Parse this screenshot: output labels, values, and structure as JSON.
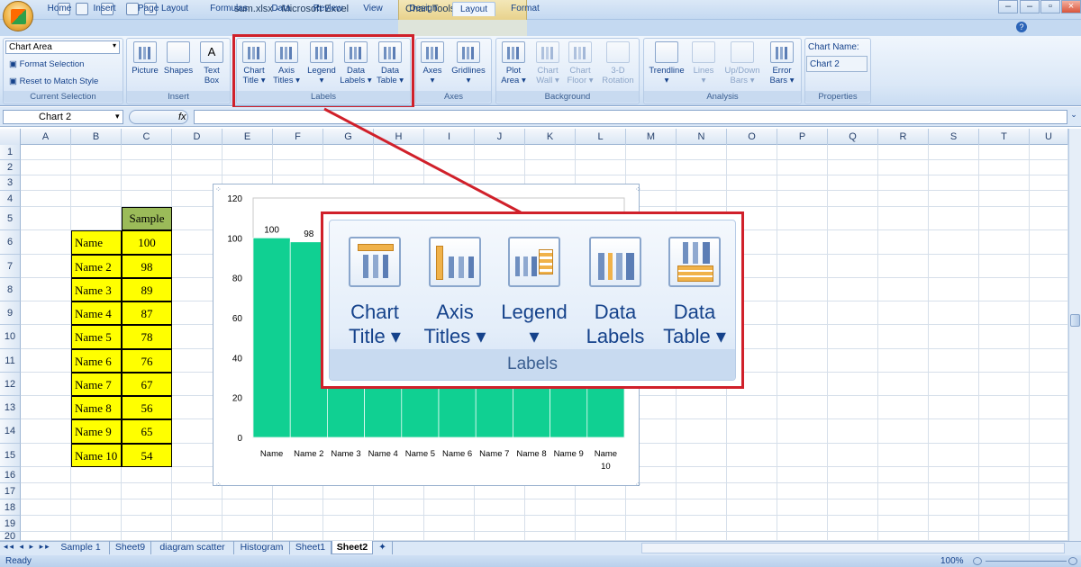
{
  "titlebar": {
    "title": "sum.xlsx - Microsoft Excel",
    "context_tab": "Chart Tools"
  },
  "tabs": [
    "Home",
    "Insert",
    "Page Layout",
    "Formulas",
    "Data",
    "Review",
    "View",
    "Design",
    "Layout",
    "Format"
  ],
  "active_tab": "Layout",
  "ribbon": {
    "current_selection": {
      "dropdown": "Chart Area",
      "format": "Format Selection",
      "reset": "Reset to Match Style",
      "label": "Current Selection"
    },
    "insert": {
      "label": "Insert",
      "buttons": [
        "Picture",
        "Shapes",
        "Text Box"
      ]
    },
    "labels": {
      "label": "Labels",
      "buttons": [
        [
          "Chart",
          "Title ▾"
        ],
        [
          "Axis",
          "Titles ▾"
        ],
        [
          "Legend",
          "▾"
        ],
        [
          "Data",
          "Labels ▾"
        ],
        [
          "Data",
          "Table ▾"
        ]
      ]
    },
    "axes": {
      "label": "Axes",
      "buttons": [
        [
          "Axes",
          "▾"
        ],
        [
          "Gridlines",
          "▾"
        ]
      ]
    },
    "background": {
      "label": "Background",
      "buttons": [
        [
          "Plot",
          "Area ▾"
        ],
        [
          "Chart",
          "Wall ▾"
        ],
        [
          "Chart",
          "Floor ▾"
        ],
        [
          "3-D",
          "Rotation"
        ]
      ]
    },
    "analysis": {
      "label": "Analysis",
      "buttons": [
        [
          "Trendline",
          "▾"
        ],
        [
          "Lines",
          "▾"
        ],
        [
          "Up/Down",
          "Bars ▾"
        ],
        [
          "Error",
          "Bars ▾"
        ]
      ]
    },
    "properties": {
      "label": "Properties",
      "name_label": "Chart Name:",
      "name_value": "Chart 2"
    }
  },
  "formula_bar": {
    "name_box": "Chart 2",
    "fx": "fx",
    "value": ""
  },
  "columns": [
    "A",
    "B",
    "C",
    "D",
    "E",
    "F",
    "G",
    "H",
    "I",
    "J",
    "K",
    "L",
    "M",
    "N",
    "O",
    "P",
    "Q",
    "R",
    "S",
    "T",
    "U"
  ],
  "rows": [
    "1",
    "2",
    "3",
    "4",
    "5",
    "6",
    "7",
    "8",
    "9",
    "10",
    "11",
    "12",
    "13",
    "14",
    "15",
    "16",
    "17",
    "18",
    "19",
    "20"
  ],
  "table": {
    "header": "Sample",
    "names": [
      "Name",
      "Name 2",
      "Name 3",
      "Name 4",
      "Name 5",
      "Name 6",
      "Name 7",
      "Name 8",
      "Name 9",
      "Name 10"
    ],
    "values": [
      "100",
      "98",
      "89",
      "87",
      "78",
      "76",
      "67",
      "56",
      "65",
      "54"
    ]
  },
  "chart_data": {
    "type": "bar",
    "categories": [
      "Name",
      "Name 2",
      "Name 3",
      "Name 4",
      "Name 5",
      "Name 6",
      "Name 7",
      "Name 8",
      "Name 9",
      "Name 10"
    ],
    "values": [
      100,
      98,
      89,
      87,
      78,
      76,
      67,
      56,
      65,
      54
    ],
    "data_labels_shown": [
      "100",
      "98"
    ],
    "ylim": [
      0,
      120
    ],
    "yticks": [
      "0",
      "20",
      "40",
      "60",
      "80",
      "100",
      "120"
    ],
    "title": "",
    "xlabel": "",
    "ylabel": "",
    "bar_color": "#10d092",
    "grid": false
  },
  "zoom": {
    "buttons": [
      [
        "Chart",
        "Title ▾"
      ],
      [
        "Axis",
        "Titles ▾"
      ],
      [
        "Legend",
        "▾"
      ],
      [
        "Data",
        "Labels ▾"
      ],
      [
        "Data",
        "Table ▾"
      ]
    ],
    "label": "Labels"
  },
  "sheets": [
    "Sample 1",
    "Sheet9",
    "diagram scatter",
    "Histogram",
    "Sheet1",
    "Sheet2"
  ],
  "active_sheet": "Sheet2",
  "status": {
    "ready": "Ready",
    "zoom": "100%"
  },
  "colors": {
    "highlight": "#d0202a",
    "cell_fill": "#ffff00",
    "header_fill": "#9bbb59"
  }
}
